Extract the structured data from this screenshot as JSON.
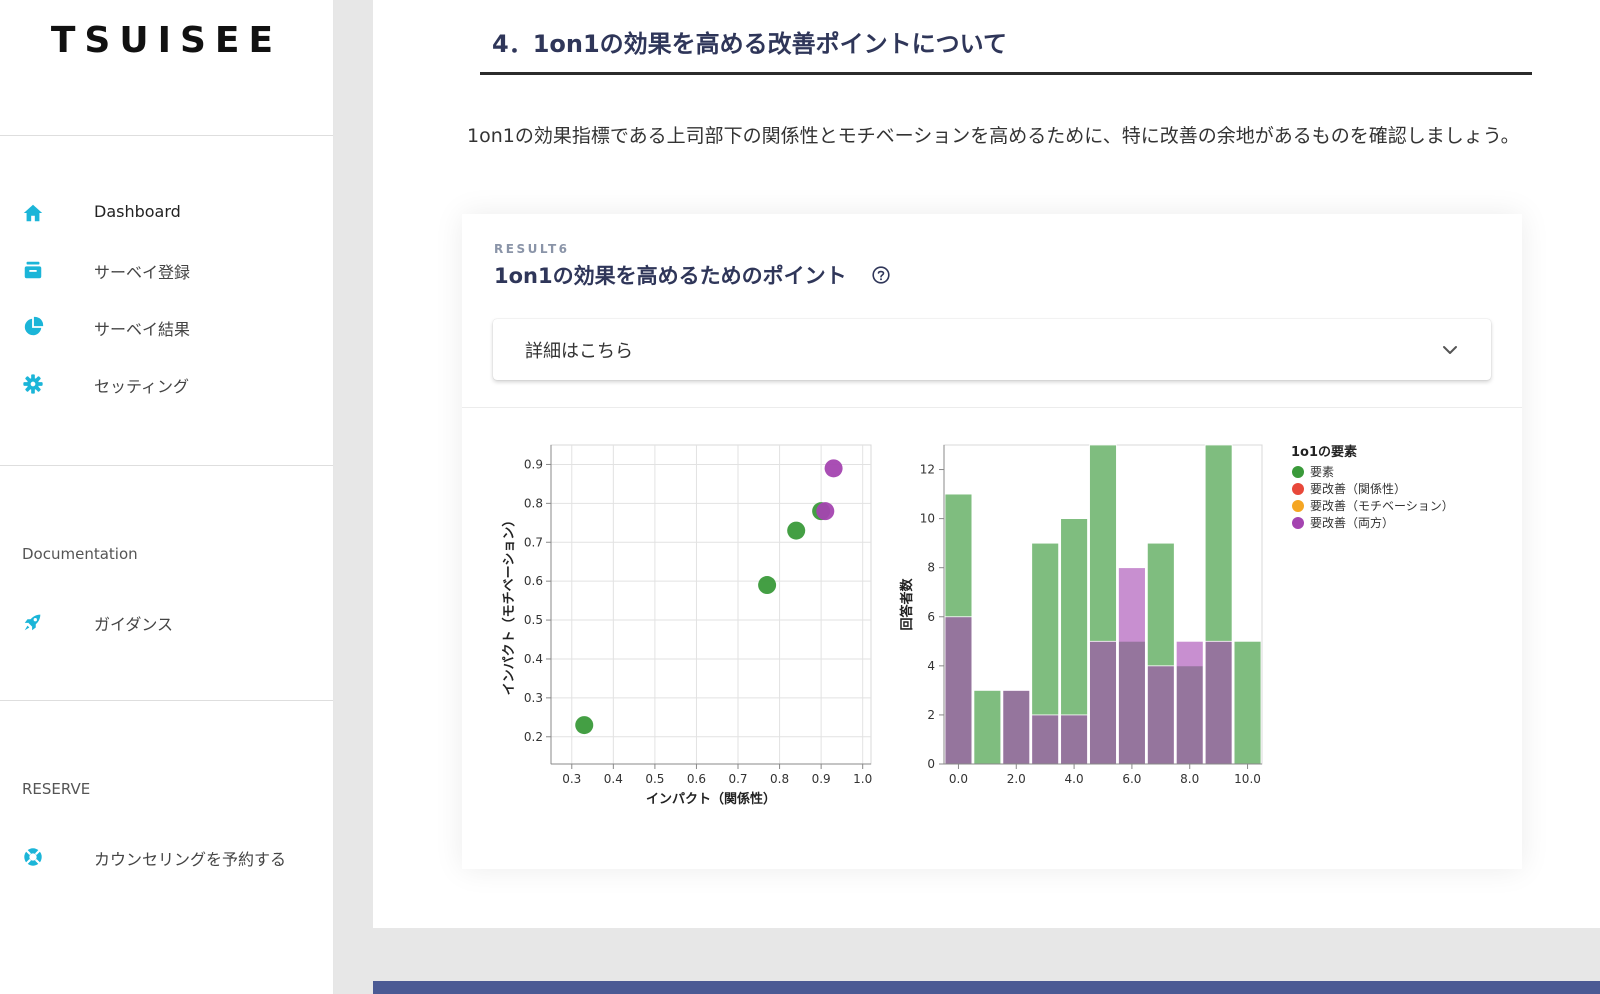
{
  "brand": {
    "logo": "TSUISEE"
  },
  "nav": {
    "main": [
      {
        "label": "Dashboard",
        "icon": "home-icon"
      },
      {
        "label": "サーベイ登録",
        "icon": "archive-icon"
      },
      {
        "label": "サーベイ結果",
        "icon": "pie-chart-icon"
      },
      {
        "label": "セッティング",
        "icon": "gear-icon"
      }
    ],
    "documentation_heading": "Documentation",
    "documentation": [
      {
        "label": "ガイダンス",
        "icon": "rocket-icon"
      }
    ],
    "reserve_heading": "RESERVE",
    "reserve": [
      {
        "label": "カウンセリングを予約する",
        "icon": "lifebuoy-icon"
      }
    ]
  },
  "section": {
    "title": "4．1on1の効果を高める改善ポイントについて",
    "intro": "1on1の効果指標である上司部下の関係性とモチベーションを高めるために、特に改善の余地があるものを確認しましょう。"
  },
  "card": {
    "kicker": "RESULT6",
    "title": "1on1の効果を高めるためのポイント",
    "accordion_label": "詳細はこちら"
  },
  "colors": {
    "accent": "#1bb5d8",
    "heading": "#2f3659",
    "green": "#3a9a3a",
    "red": "#e8483a",
    "orange": "#f5a623",
    "purple": "#a444b0",
    "footer_bar": "#4b5a94"
  },
  "chart_data": [
    {
      "type": "scatter",
      "xlabel": "インパクト（関係性）",
      "ylabel": "インパクト（モチベーション）",
      "xlim": [
        0.25,
        1.02
      ],
      "ylim": [
        0.13,
        0.95
      ],
      "xticks": [
        "0.3",
        "0.4",
        "0.5",
        "0.6",
        "0.7",
        "0.8",
        "0.9",
        "1.0"
      ],
      "yticks": [
        "0.2",
        "0.3",
        "0.4",
        "0.5",
        "0.6",
        "0.7",
        "0.8",
        "0.9"
      ],
      "grid": true,
      "points": [
        {
          "x": 0.33,
          "y": 0.23,
          "group": "要素"
        },
        {
          "x": 0.77,
          "y": 0.59,
          "group": "要素"
        },
        {
          "x": 0.84,
          "y": 0.73,
          "group": "要素"
        },
        {
          "x": 0.9,
          "y": 0.78,
          "group": "要素"
        },
        {
          "x": 0.91,
          "y": 0.78,
          "group": "要改善（両方）"
        },
        {
          "x": 0.93,
          "y": 0.89,
          "group": "要改善（両方）"
        }
      ]
    },
    {
      "type": "bar",
      "stacked": false,
      "overlay": true,
      "ylabel": "回答者数",
      "xlabel": "",
      "ylim": [
        0,
        13
      ],
      "yticks": [
        "0",
        "2",
        "4",
        "6",
        "8",
        "10",
        "12"
      ],
      "xticks": [
        "0.0",
        "2.0",
        "4.0",
        "6.0",
        "8.0",
        "10.0"
      ],
      "categories": [
        "0",
        "1",
        "2",
        "3",
        "4",
        "5",
        "6",
        "7",
        "8",
        "9",
        "10"
      ],
      "series": [
        {
          "name": "要素",
          "values": [
            11,
            3,
            3,
            9,
            10,
            13,
            5,
            9,
            4,
            13,
            5
          ]
        },
        {
          "name": "要改善（両方）",
          "values": [
            6,
            0,
            3,
            2,
            2,
            5,
            8,
            4,
            5,
            5,
            0
          ]
        }
      ],
      "legend": {
        "title": "1o1の要素",
        "position": "right",
        "items": [
          "要素",
          "要改善（関係性）",
          "要改善（モチベーション）",
          "要改善（両方）"
        ]
      }
    }
  ]
}
